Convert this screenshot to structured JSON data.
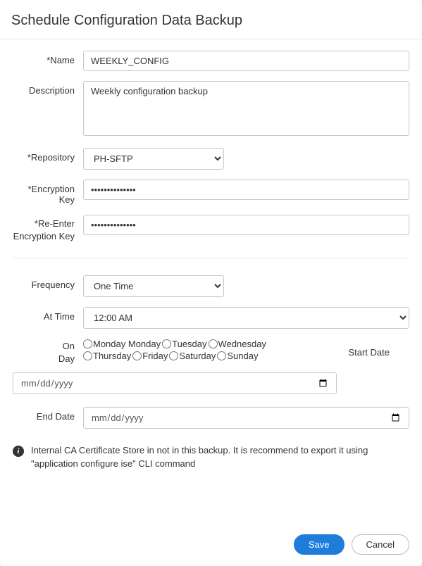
{
  "header": {
    "title": "Schedule Configuration Data Backup"
  },
  "form": {
    "name_label": "*Name",
    "name_value": "WEEKLY_CONFIG",
    "description_label": "Description",
    "description_value": "Weekly configuration backup",
    "repository_label": "*Repository",
    "repository_value": "PH-SFTP",
    "encryption_key_label": "*Encryption Key",
    "encryption_key_value": "••••••••••••••",
    "reenter_key_label": "*Re-Enter Encryption Key",
    "reenter_key_value": "••••••••••••••"
  },
  "schedule": {
    "frequency_label": "Frequency",
    "frequency_value": "One Time",
    "at_time_label": "At Time",
    "at_time_value": "12:00 AM",
    "on_label_line1": "On",
    "on_label_line2": "Day",
    "days": [
      {
        "label": "Monday Monday"
      },
      {
        "label": "Tuesday"
      },
      {
        "label": "Wednesday"
      },
      {
        "label": "Thursday"
      },
      {
        "label": "Friday"
      },
      {
        "label": "Saturday"
      },
      {
        "label": "Sunday"
      }
    ],
    "start_date_label": "Start Date",
    "start_date_placeholder": "mm/dd/yyyy",
    "end_date_label": "End Date",
    "end_date_placeholder": "mm/dd/yyyy"
  },
  "info": {
    "text": "Internal CA Certificate Store in not in this backup. It is recommend to export it using \"application configure ise\" CLI command"
  },
  "footer": {
    "save_label": "Save",
    "cancel_label": "Cancel"
  }
}
